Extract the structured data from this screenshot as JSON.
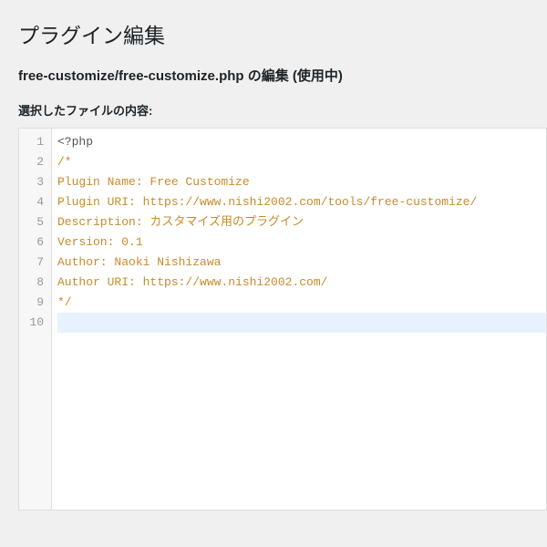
{
  "header": {
    "page_title": "プラグイン編集",
    "file_heading": "free-customize/free-customize.php の編集 (使用中)",
    "content_label": "選択したファイルの内容:"
  },
  "editor": {
    "active_line": 10,
    "lines": [
      {
        "n": 1,
        "text": "<?php",
        "cls": "tok-meta"
      },
      {
        "n": 2,
        "text": "/*",
        "cls": "tok-comment"
      },
      {
        "n": 3,
        "text": "Plugin Name: Free Customize",
        "cls": "tok-comment"
      },
      {
        "n": 4,
        "text": "Plugin URI: https://www.nishi2002.com/tools/free-customize/",
        "cls": "tok-comment"
      },
      {
        "n": 5,
        "text": "Description: カスタマイズ用のプラグイン",
        "cls": "tok-comment"
      },
      {
        "n": 6,
        "text": "Version: 0.1",
        "cls": "tok-comment"
      },
      {
        "n": 7,
        "text": "Author: Naoki Nishizawa",
        "cls": "tok-comment"
      },
      {
        "n": 8,
        "text": "Author URI: https://www.nishi2002.com/",
        "cls": "tok-comment"
      },
      {
        "n": 9,
        "text": "*/",
        "cls": "tok-comment"
      },
      {
        "n": 10,
        "text": "",
        "cls": ""
      }
    ]
  }
}
